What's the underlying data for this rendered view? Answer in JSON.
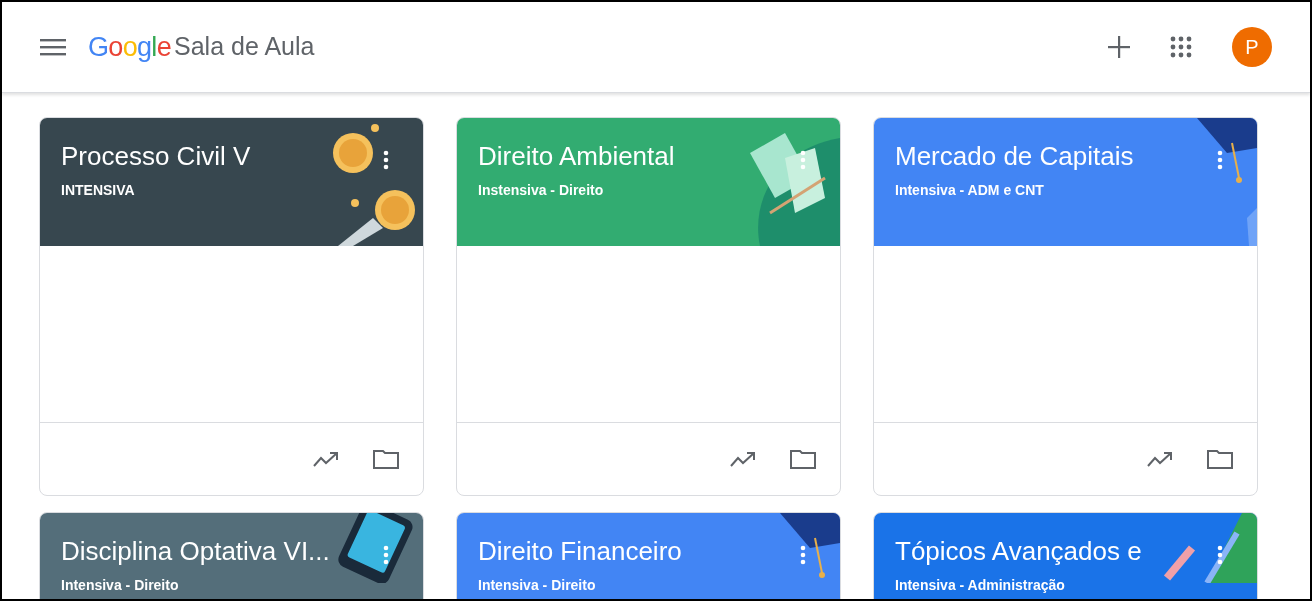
{
  "header": {
    "logo": "Google",
    "product": "Sala de Aula",
    "avatar_letter": "P"
  },
  "classes": [
    {
      "title": "Processo Civil V",
      "subtitle": "INTENSIVA",
      "color": "#37474f",
      "kind": "coins"
    },
    {
      "title": "Direito Ambiental",
      "subtitle": "Instensiva - Direito",
      "color": "#32ac71",
      "kind": "book"
    },
    {
      "title": "Mercado de Capitais",
      "subtitle": "Intensiva - ADM e CNT",
      "color": "#4285f4",
      "kind": "cap"
    },
    {
      "title": "Disciplina Optativa VI...",
      "subtitle": "Intensiva - Direito",
      "color": "#546e7a",
      "kind": "phone"
    },
    {
      "title": "Direito Financeiro",
      "subtitle": "Intensiva - Direito",
      "color": "#4285f4",
      "kind": "cap"
    },
    {
      "title": "Tópicos Avançados e",
      "subtitle": "Intensiva - Administração",
      "color": "#1a73e8",
      "kind": "pencil"
    }
  ]
}
